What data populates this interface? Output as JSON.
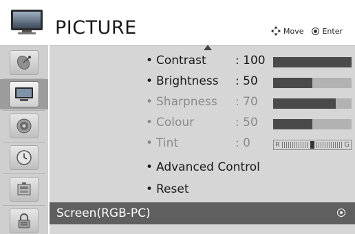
{
  "header": {
    "title": "PICTURE",
    "hint_move": "Move",
    "hint_enter": "Enter",
    "tv_icon": "tv-monitor-icon",
    "move_icon": "four-way-arrows-icon",
    "enter_icon": "ok-button-icon"
  },
  "sidebar": {
    "items": [
      {
        "icon": "satellite-dish-icon",
        "active": false
      },
      {
        "icon": "picture-monitor-icon",
        "active": true
      },
      {
        "icon": "speaker-audio-icon",
        "active": false
      },
      {
        "icon": "clock-time-icon",
        "active": false
      },
      {
        "icon": "option-box-icon",
        "active": false
      },
      {
        "icon": "lock-icon",
        "active": false
      }
    ]
  },
  "menu": {
    "bullet": "•",
    "contrast": {
      "label": "Contrast",
      "value": ": 100",
      "level": 1.0
    },
    "brightness": {
      "label": "Brightness",
      "value": ": 50",
      "level": 0.5
    },
    "sharpness": {
      "label": "Sharpness",
      "value": ": 70",
      "level": 0.8
    },
    "colour": {
      "label": "Colour",
      "value": ": 50",
      "level": 0.5
    },
    "tint": {
      "label": "Tint",
      "value": ": 0",
      "scale_left": "R",
      "scale_right": "G"
    },
    "advanced": {
      "label": "Advanced Control"
    },
    "reset": {
      "label": "Reset"
    },
    "screen": {
      "label": "Screen(RGB-PC)"
    }
  },
  "colors": {
    "panel": "#d6d6d6",
    "sidebar": "#cfcfcf",
    "highlight_row": "#5f5f5f",
    "bar_fill": "#4a4a4a",
    "bar_track": "#b2b2b2",
    "dim_text": "#8a8a8a"
  }
}
